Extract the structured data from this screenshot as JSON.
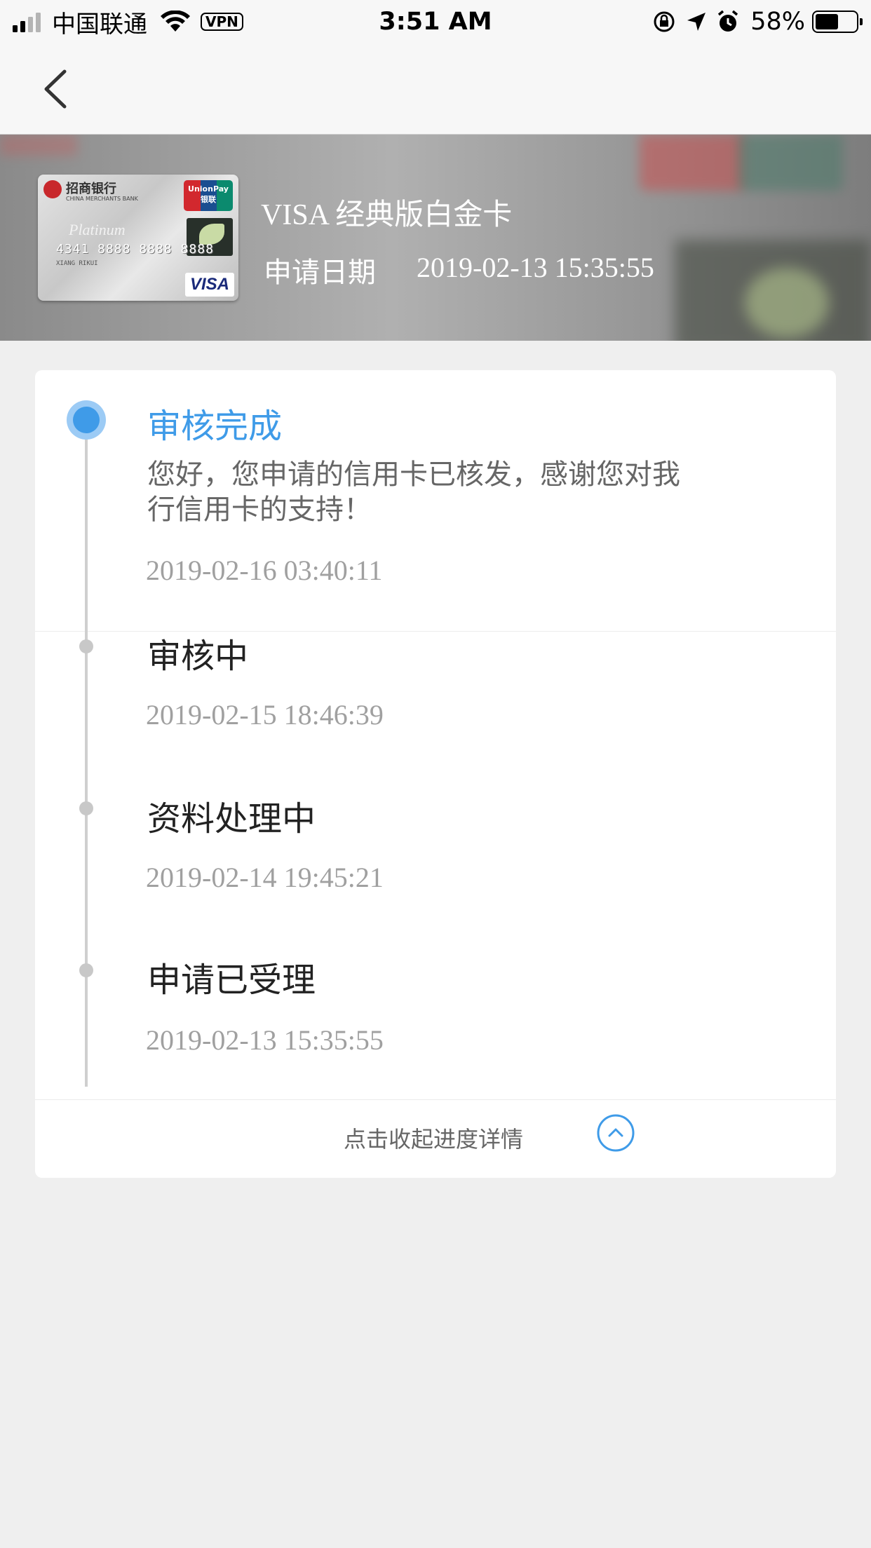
{
  "status_bar": {
    "carrier": "中国联通",
    "vpn": "VPN",
    "time": "3:51 AM",
    "battery_percent": "58%",
    "battery_level": 0.58,
    "icons": [
      "signal-icon",
      "wifi-icon",
      "orientation-lock-icon",
      "location-icon",
      "alarm-icon",
      "battery-icon"
    ]
  },
  "nav": {
    "back_icon": "chevron-left-icon"
  },
  "header": {
    "card_name": "VISA 经典版白金卡",
    "apply_date_label": "申请日期",
    "apply_date_value": "2019-02-13 15:35:55",
    "card_image": {
      "bank_name": "招商银行",
      "bank_name_en": "CHINA MERCHANTS BANK",
      "unionpay": "UnionPay 银联",
      "platinum": "Platinum",
      "number": "4341 8888 8888 8888",
      "holder": "XIANG RIKUI",
      "brand": "VISA"
    }
  },
  "progress": {
    "accent_color": "#3f9be8",
    "steps": [
      {
        "title": "审核完成",
        "desc": "您好，您申请的信用卡已核发，感谢您对我行信用卡的支持！",
        "time": "2019-02-16 03:40:11",
        "active": true
      },
      {
        "title": "审核中",
        "time": "2019-02-15 18:46:39",
        "active": false
      },
      {
        "title": "资料处理中",
        "time": "2019-02-14 19:45:21",
        "active": false
      },
      {
        "title": "申请已受理",
        "time": "2019-02-13 15:35:55",
        "active": false
      }
    ],
    "collapse_label": "点击收起进度详情",
    "collapse_icon": "chevron-up-circle-icon"
  }
}
